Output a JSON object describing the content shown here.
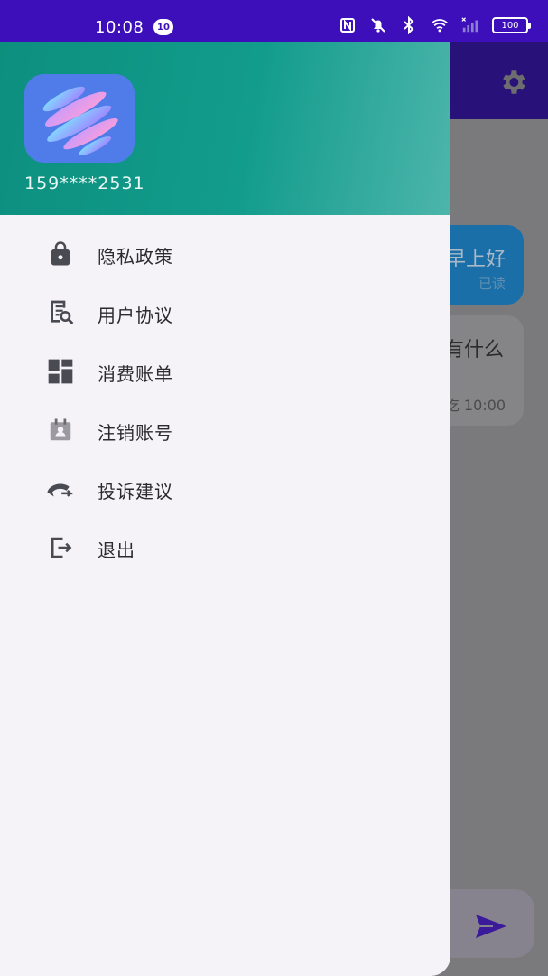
{
  "status_bar": {
    "time": "10:08",
    "notification_count": "10",
    "battery": "100",
    "icons": [
      "nfc-icon",
      "mute-icon",
      "bluetooth-icon",
      "wifi-icon",
      "signal-icon",
      "battery-icon"
    ]
  },
  "background": {
    "settings_icon": "gear-icon",
    "user_message_partial": "早上好",
    "user_message_status_partial": "已读",
    "bot_message_partial": "有什么",
    "bot_message_time_partial": "吃 10:00",
    "send_icon": "send-icon"
  },
  "drawer": {
    "phone": "159****2531",
    "menu": [
      {
        "label": "隐私政策",
        "icon": "lock-icon"
      },
      {
        "label": "用户协议",
        "icon": "document-search-icon"
      },
      {
        "label": "消费账单",
        "icon": "dashboard-icon"
      },
      {
        "label": "注销账号",
        "icon": "account-cancel-icon"
      },
      {
        "label": "投诉建议",
        "icon": "phone-forward-icon"
      },
      {
        "label": "退出",
        "icon": "logout-icon"
      }
    ]
  },
  "colors": {
    "status_bar": "#3d0fba",
    "drawer_header_start": "#0d8f7e",
    "drawer_header_end": "#4db5ab",
    "drawer_bg": "#f5f2f8",
    "menu_text": "#2b2b2e"
  }
}
